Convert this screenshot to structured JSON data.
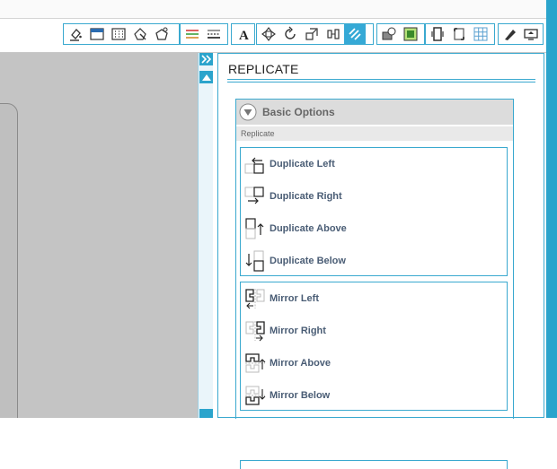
{
  "panel": {
    "title": "REPLICATE"
  },
  "basic_options": {
    "label": "Basic Options",
    "section_label": "Replicate"
  },
  "duplicate_group": [
    {
      "label": "Duplicate Left",
      "icon": "duplicate-left-icon"
    },
    {
      "label": "Duplicate Right",
      "icon": "duplicate-right-icon"
    },
    {
      "label": "Duplicate Above",
      "icon": "duplicate-above-icon"
    },
    {
      "label": "Duplicate Below",
      "icon": "duplicate-below-icon"
    }
  ],
  "mirror_group": [
    {
      "label": "Mirror Left",
      "icon": "mirror-left-icon"
    },
    {
      "label": "Mirror Right",
      "icon": "mirror-right-icon"
    },
    {
      "label": "Mirror Above",
      "icon": "mirror-above-icon"
    },
    {
      "label": "Mirror Below",
      "icon": "mirror-below-icon"
    }
  ],
  "toolbar": {
    "groups": [
      [
        "fill-bucket-icon",
        "line-color-icon",
        "fill-pattern-icon",
        "point-editor-icon",
        "shape-edit-icon"
      ],
      [
        "line-style-icon",
        "line-thickness-icon"
      ],
      [
        "text-style-icon"
      ],
      [
        "transform-icon",
        "rotate-icon",
        "scale-icon",
        "align-icon",
        "replicate-icon"
      ],
      [
        "offset-icon",
        "trace-icon"
      ],
      [
        "page-setup-icon",
        "registration-icon",
        "grid-icon"
      ],
      [
        "cut-settings-icon",
        "send-to-cutter-icon"
      ]
    ],
    "active": "replicate-icon"
  },
  "colors": {
    "accent": "#2ba4cc",
    "canvas": "#c4c4c4",
    "header_bg": "#dcdcdc",
    "label_text": "#4a5d75"
  }
}
